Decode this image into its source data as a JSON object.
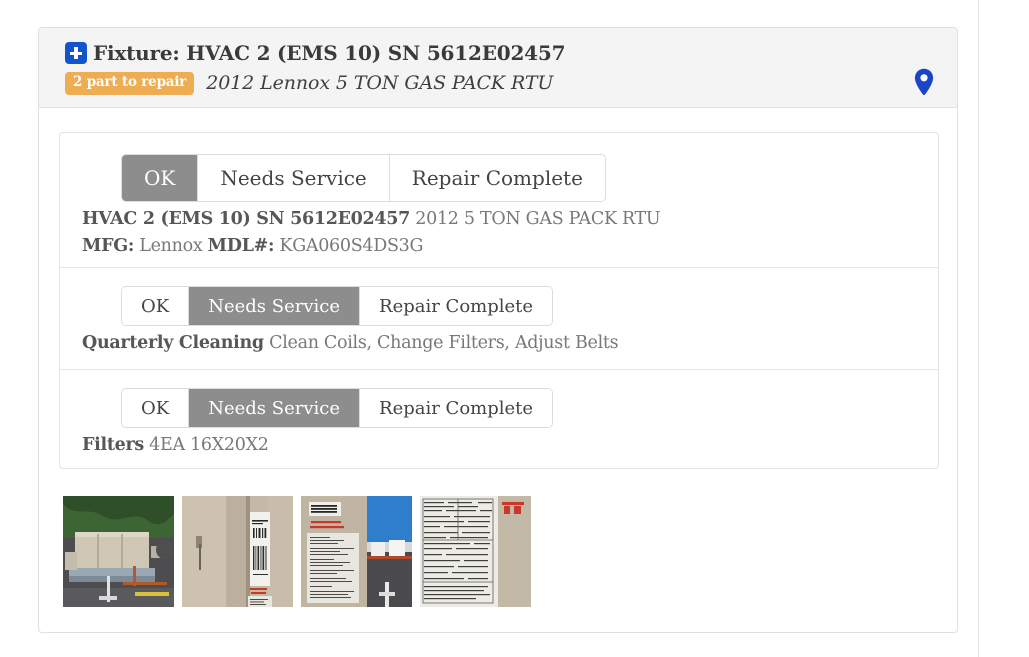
{
  "card": {
    "header": {
      "icon": "plus-square-icon",
      "title": "Fixture: HVAC 2 (EMS 10) SN 5612E02457",
      "badge": "2 part to repair",
      "model": "2012 Lennox 5 TON GAS PACK RTU",
      "map_icon": "map-pin-icon",
      "accent_badge_color": "#eead52",
      "accent_icon_color": "#1154cc"
    },
    "sections": [
      {
        "buttons": [
          "OK",
          "Needs Service",
          "Repair Complete"
        ],
        "selected": "OK",
        "line1_bold": "HVAC 2 (EMS 10) SN 5612E02457",
        "line1_rest": " 2012 5 TON GAS PACK RTU",
        "line2_label1": "MFG:",
        "line2_value1": " Lennox ",
        "line2_label2": "MDL#:",
        "line2_value2": " KGA060S4DS3G"
      },
      {
        "buttons": [
          "OK",
          "Needs Service",
          "Repair Complete"
        ],
        "selected": "Needs Service",
        "line1_bold": "Quarterly Cleaning",
        "line1_rest": " Clean Coils, Change Filters, Adjust Belts"
      },
      {
        "buttons": [
          "OK",
          "Needs Service",
          "Repair Complete"
        ],
        "selected": "Needs Service",
        "line1_bold": "Filters",
        "line1_rest": " 4EA 16X20X2"
      }
    ],
    "photos": [
      {
        "name": "photo-rooftop-hvac-unit"
      },
      {
        "name": "photo-barcode-label"
      },
      {
        "name": "photo-nameplate-rooftop"
      },
      {
        "name": "photo-data-plate"
      }
    ]
  }
}
